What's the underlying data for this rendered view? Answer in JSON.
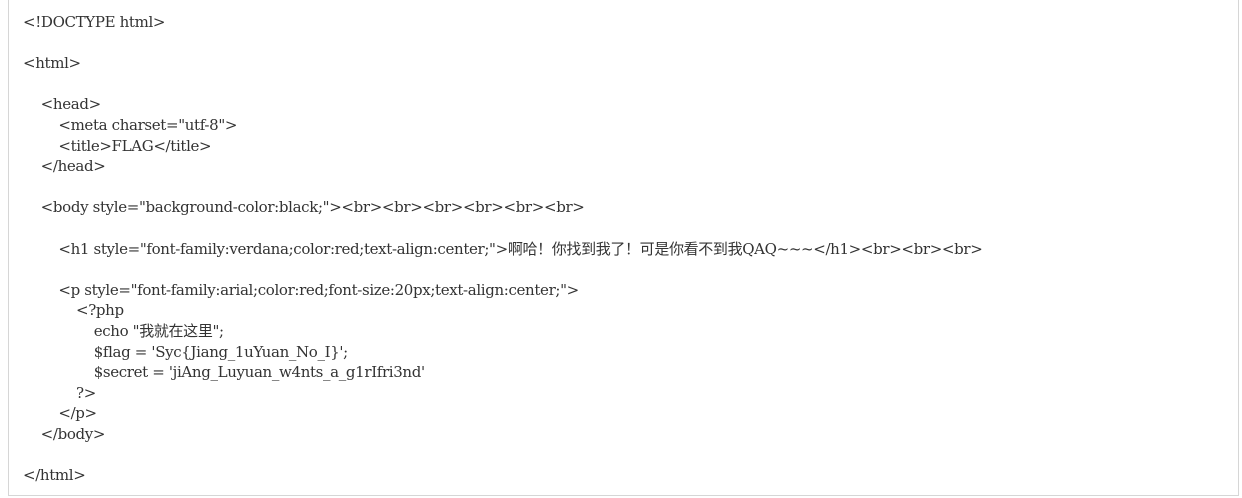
{
  "code": {
    "lines": [
      "<!DOCTYPE html>",
      "",
      "<html>",
      "",
      "    <head>",
      "        <meta charset=\"utf-8\">",
      "        <title>FLAG</title>",
      "    </head>",
      "",
      "    <body style=\"background-color:black;\"><br><br><br><br><br><br>",
      "",
      "        <h1 style=\"font-family:verdana;color:red;text-align:center;\">啊哈！你找到我了！可是你看不到我QAQ~~~</h1><br><br><br>",
      "",
      "        <p style=\"font-family:arial;color:red;font-size:20px;text-align:center;\">",
      "            <?php",
      "                echo \"我就在这里\";",
      "                $flag = 'Syc{Jiang_1uYuan_No_I}';",
      "                $secret = 'jiAng_Luyuan_w4nts_a_g1rIfri3nd'",
      "            ?>",
      "        </p>",
      "    </body>",
      "",
      "</html>"
    ]
  }
}
